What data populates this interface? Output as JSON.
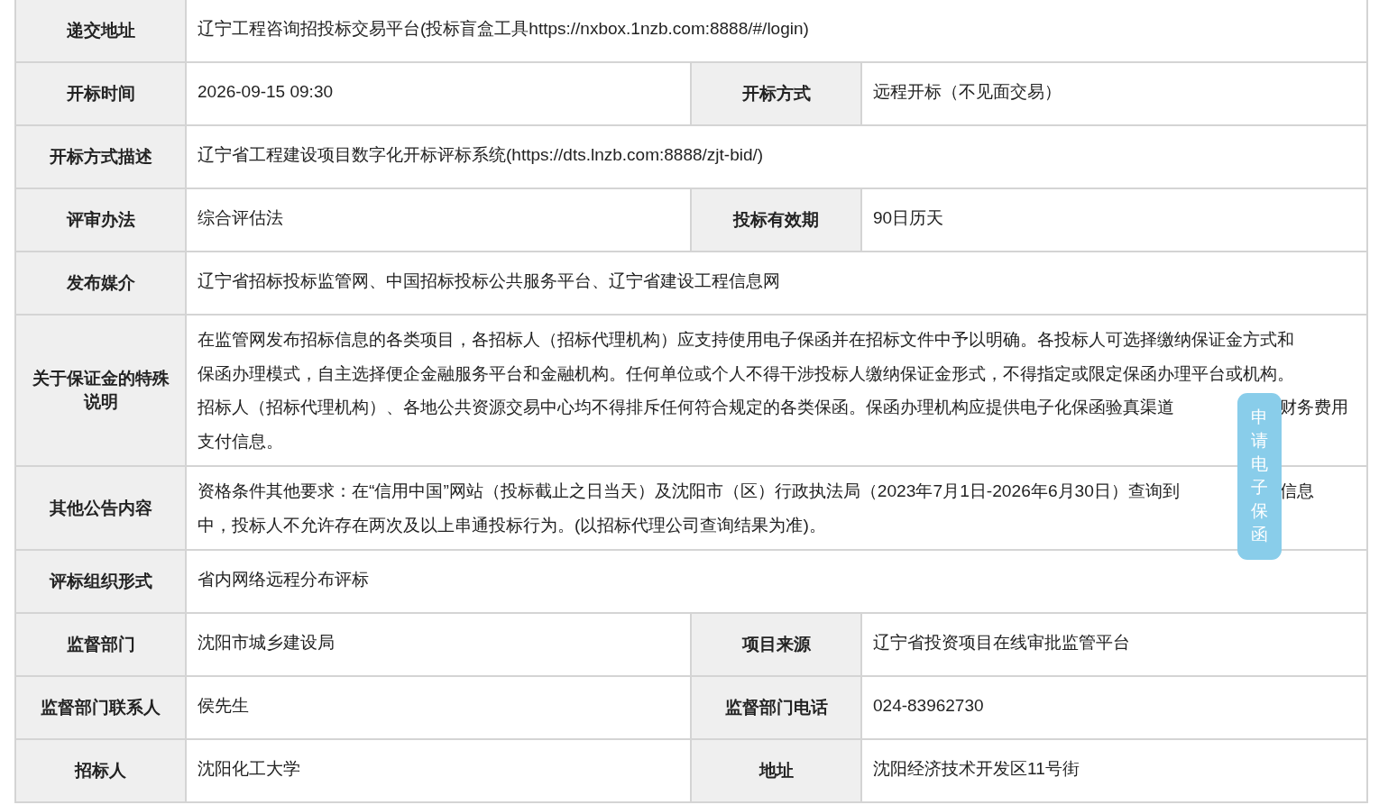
{
  "rows": [
    {
      "cells": [
        {
          "label": "递交地址",
          "value": "辽宁工程咨询招投标交易平台(投标盲盒工具https://nxbox.1nzb.com:8888/#/login)"
        }
      ]
    },
    {
      "cells": [
        {
          "label": "开标时间",
          "value": "2026-09-15 09:30"
        },
        {
          "label": "开标方式",
          "value": "远程开标（不见面交易）"
        }
      ]
    },
    {
      "cells": [
        {
          "label": "开标方式描述",
          "value": "辽宁省工程建设项目数字化开标评标系统(https://dts.lnzb.com:8888/zjt-bid/)"
        }
      ]
    },
    {
      "cells": [
        {
          "label": "评审办法",
          "value": "综合评估法"
        },
        {
          "label": "投标有效期",
          "value": "90日历天"
        }
      ]
    },
    {
      "cells": [
        {
          "label": "发布媒介",
          "value": "辽宁省招标投标监管网、中国招标投标公共服务平台、辽宁省建设工程信息网"
        }
      ]
    },
    {
      "cells": [
        {
          "label": "关于保证金的特殊说明",
          "lines": [
            "在监管网发布招标信息的各类项目，各招标人（招标代理机构）应支持使用电子保函并在招标文件中予以明确。各投标人可选择缴纳保证金方式和",
            "保函办理模式，自主选择便企金融服务平台和金融机构。任何单位或个人不得干涉投标人缴纳保证金形式，不得指定或限定保函办理平台或机构。",
            [
              "招标人（招标代理机构）、各地公共资源交易中心均不得排斥任何符合规定的各类保函。保函办理机构应提供电子化保函验真渠道",
              "财务费用"
            ],
            "支付信息。"
          ]
        }
      ]
    },
    {
      "cells": [
        {
          "label": "其他公告内容",
          "lines": [
            [
              "资格条件其他要求：在“信用中国”网站（投标截止之日当天）及沈阳市（区）行政执法局（2023年7月1日-2026年6月30日）查询到",
              "信息"
            ],
            "中，投标人不允许存在两次及以上串通投标行为。(以招标代理公司查询结果为准)。"
          ]
        }
      ]
    },
    {
      "cells": [
        {
          "label": "评标组织形式",
          "value": "省内网络远程分布评标"
        }
      ]
    },
    {
      "cells": [
        {
          "label": "监督部门",
          "value": "沈阳市城乡建设局"
        },
        {
          "label": "项目来源",
          "value": "辽宁省投资项目在线审批监管平台"
        }
      ]
    },
    {
      "cells": [
        {
          "label": "监督部门联系人",
          "value": "侯先生"
        },
        {
          "label": "监督部门电话",
          "value": "024-83962730"
        }
      ]
    },
    {
      "cells": [
        {
          "label": "招标人",
          "value": "沈阳化工大学"
        },
        {
          "label": "地址",
          "value": "沈阳经济技术开发区11号街"
        }
      ]
    }
  ],
  "float_button": {
    "label": "申请电子保函"
  }
}
